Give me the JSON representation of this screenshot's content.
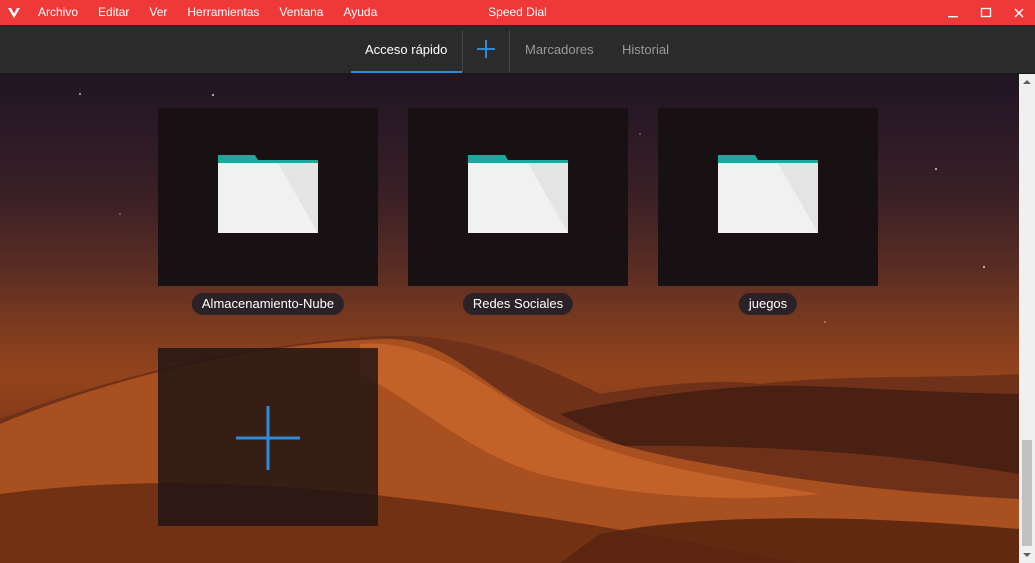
{
  "app": {
    "title": "Speed Dial",
    "brand_color": "#ef3939",
    "menu": [
      "Archivo",
      "Editar",
      "Ver",
      "Herramientas",
      "Ventana",
      "Ayuda"
    ],
    "window_controls": [
      "minimize-icon",
      "maximize-icon",
      "close-icon"
    ]
  },
  "tabs": {
    "items": [
      {
        "label": "Acceso rápido",
        "active": true
      },
      {
        "label": "Marcadores",
        "active": false
      },
      {
        "label": "Historial",
        "active": false
      }
    ],
    "add_icon": "plus-icon",
    "accent": "#2e8bd8"
  },
  "speed_dial": {
    "folders": [
      {
        "label": "Almacenamiento-Nube",
        "icon": "folder-icon"
      },
      {
        "label": "Redes Sociales",
        "icon": "folder-icon"
      },
      {
        "label": "juegos",
        "icon": "folder-icon"
      }
    ],
    "add_tile_icon": "plus-icon",
    "folder_tab_color": "#1aa99a"
  }
}
